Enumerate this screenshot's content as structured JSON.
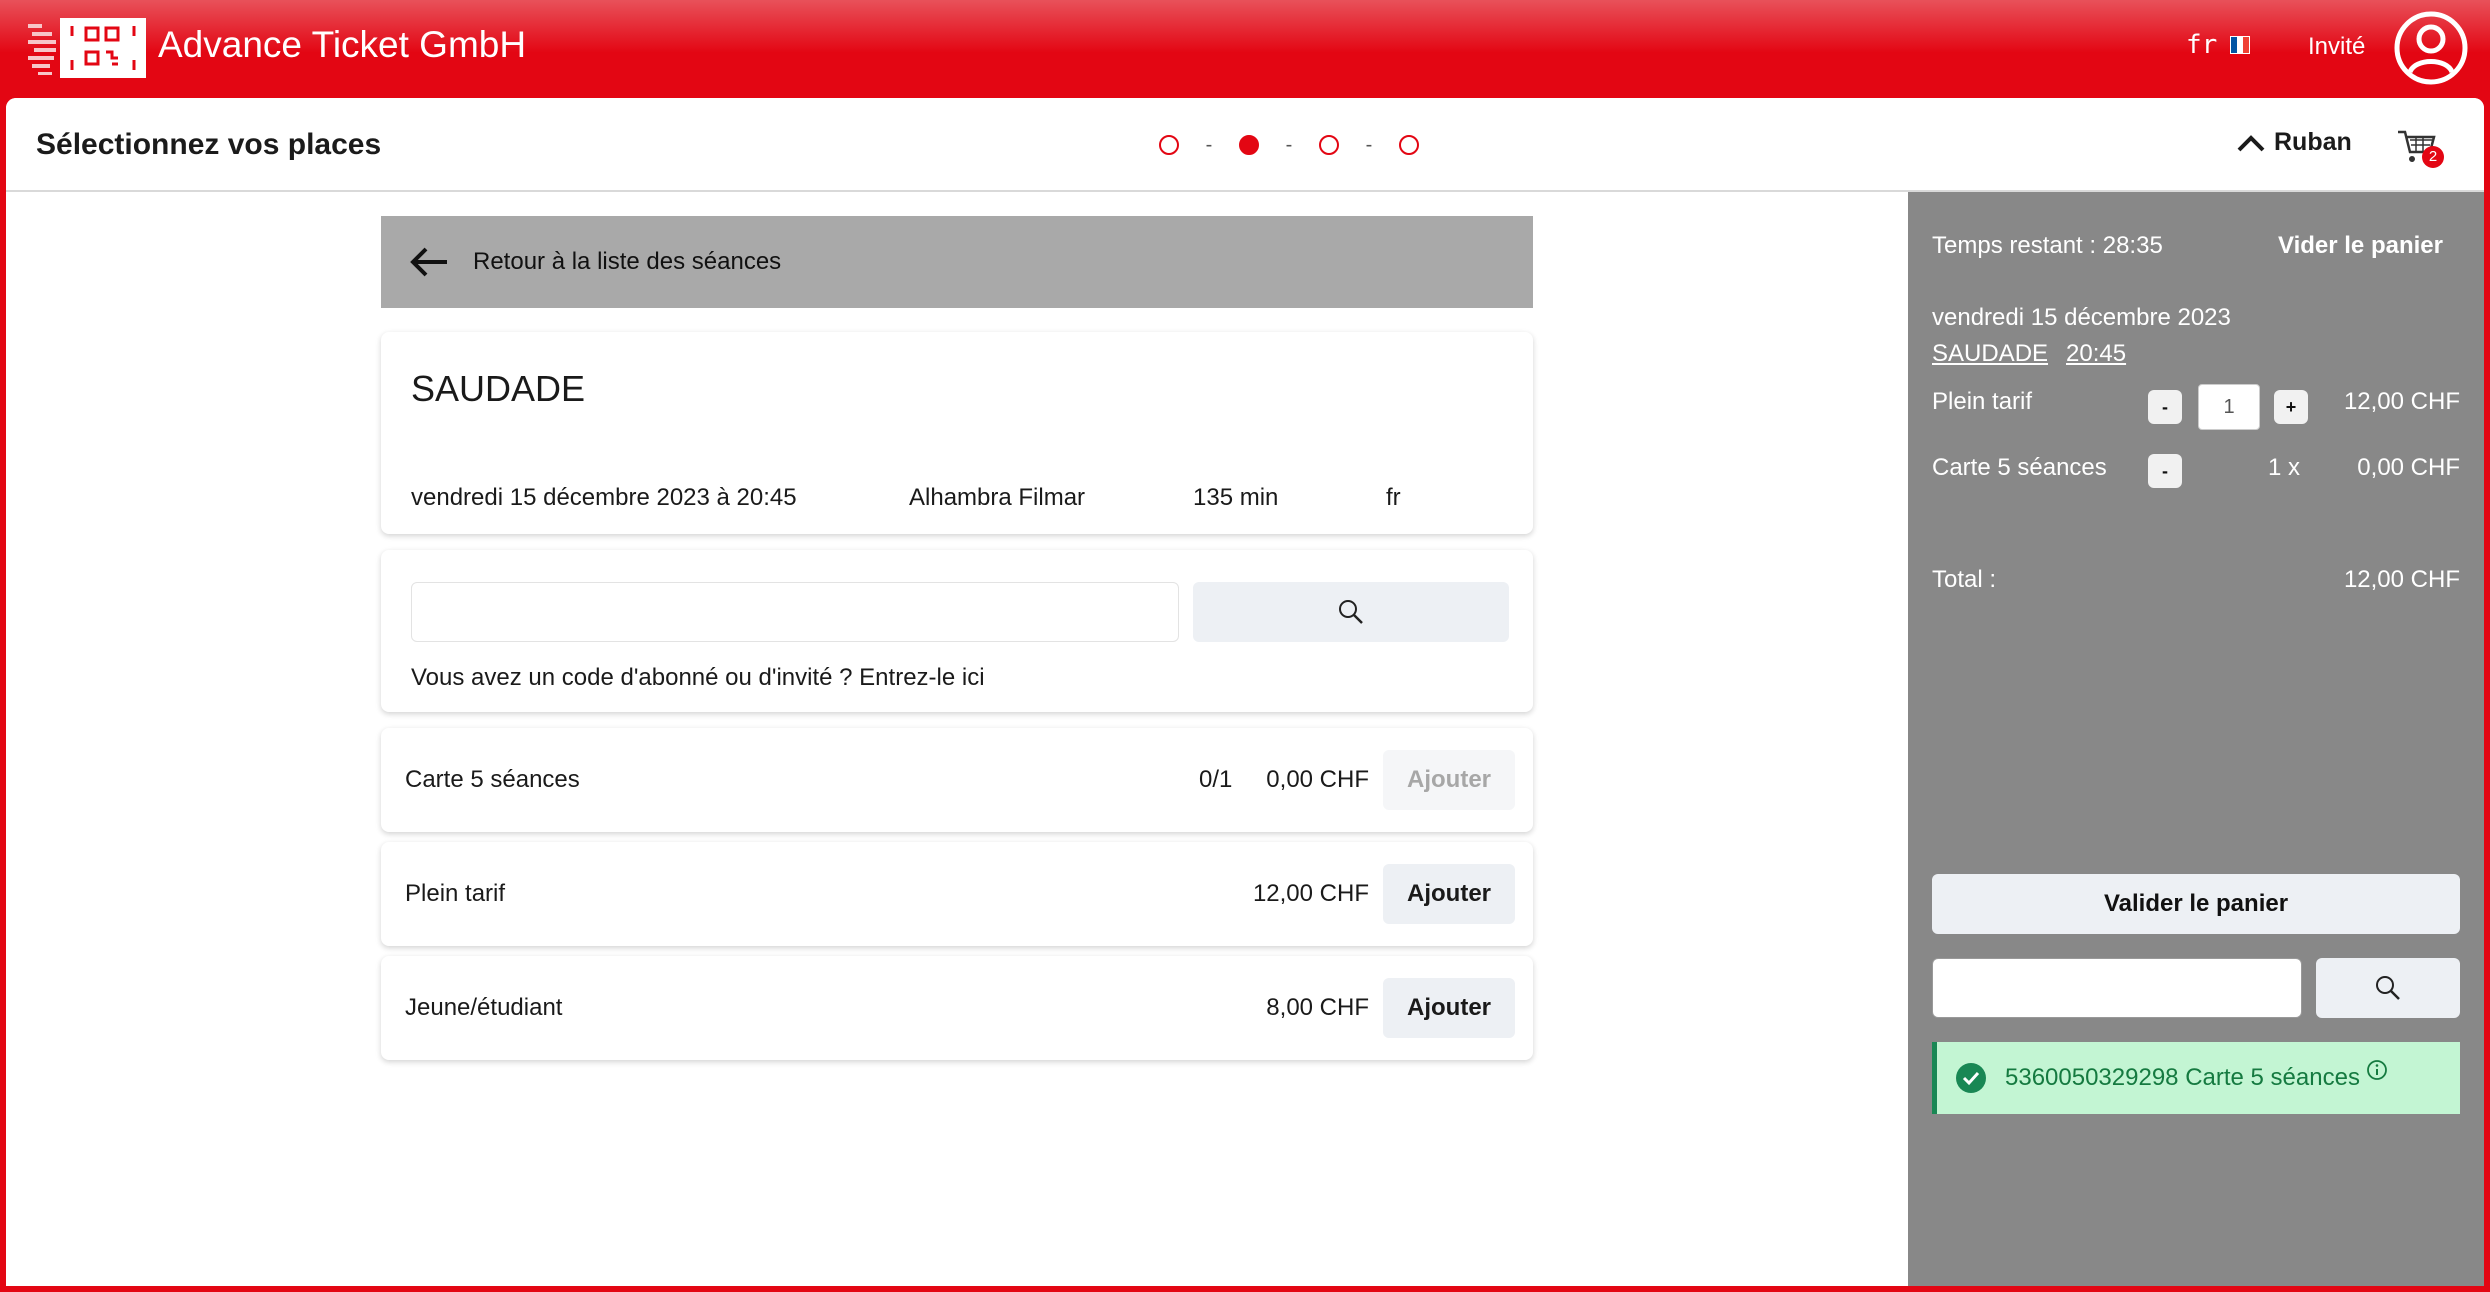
{
  "header": {
    "brand": "Advance Ticket GmbH",
    "language": "fr",
    "flag_colors": [
      "#0055a4",
      "#ffffff",
      "#ef4135"
    ],
    "user_label": "Invité",
    "logo_icon": "qr-ticket-logo",
    "avatar_icon": "user-circle-icon"
  },
  "subheader": {
    "title": "Sélectionnez vos places",
    "steps": {
      "total": 4,
      "current": 2,
      "separator": "-"
    },
    "ribbon_label": "Ruban",
    "cart_badge": "2"
  },
  "main": {
    "back_label": "Retour à la liste des séances",
    "event": {
      "title": "SAUDADE",
      "date": "vendredi 15 décembre 2023 à 20:45",
      "venue": "Alhambra Filmar",
      "duration": "135 min",
      "language": "fr"
    },
    "code": {
      "input_value": "",
      "hint": "Vous avez un code d'abonné ou d'invité ? Entrez-le ici"
    },
    "tariffs": [
      {
        "name": "Carte 5 séances",
        "qty": "0/1",
        "price": "0,00 CHF",
        "button": "Ajouter",
        "disabled": true
      },
      {
        "name": "Plein tarif",
        "qty": "",
        "price": "12,00 CHF",
        "button": "Ajouter",
        "disabled": false
      },
      {
        "name": "Jeune/étudiant",
        "qty": "",
        "price": "8,00 CHF",
        "button": "Ajouter",
        "disabled": false
      }
    ]
  },
  "cart": {
    "time_remaining": "Temps restant : 28:35",
    "empty_label": "Vider le panier",
    "date": "vendredi 15 décembre 2023",
    "film": "SAUDADE",
    "time": "20:45",
    "items": [
      {
        "name": "Plein tarif",
        "minus": "-",
        "qty": "1",
        "plus": "+",
        "price": "12,00 CHF"
      },
      {
        "name": "Carte 5 séances",
        "minus": "-",
        "qty": "1 x",
        "price": "0,00 CHF"
      }
    ],
    "total_label": "Total :",
    "total_value": "12,00 CHF",
    "validate_label": "Valider le panier",
    "voucher_input": "",
    "alert_text": "5360050329298 Carte 5 séances",
    "alert_color": "#c3f5d3"
  }
}
